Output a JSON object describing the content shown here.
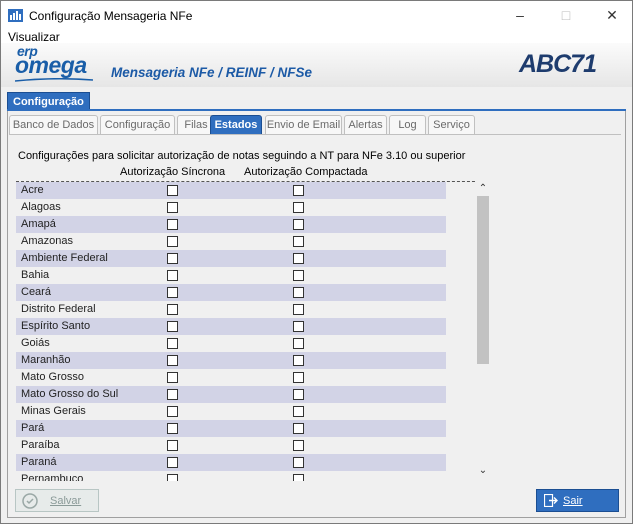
{
  "window": {
    "title": "Configuração Mensageria NFe"
  },
  "menu": {
    "items": [
      "Visualizar"
    ]
  },
  "banner": {
    "logo_erp": "erp",
    "logo_omega": "omega",
    "title": "Mensageria NFe / REINF / NFSe",
    "brand": "ABC71"
  },
  "main_tab": {
    "label": "Configuração"
  },
  "subtabs": [
    "Banco de Dados",
    "Configuração",
    "Filas",
    "Estados",
    "Envio de Email",
    "Alertas",
    "Log",
    "Serviço"
  ],
  "active_subtab": "Estados",
  "content": {
    "description": "Configurações para solicitar autorização de notas seguindo a NT para NFe 3.10 ou superior",
    "col_sincrona": "Autorização Síncrona",
    "col_compactada": "Autorização Compactada"
  },
  "states": [
    {
      "name": "Acre",
      "sincrona": false,
      "compactada": false
    },
    {
      "name": "Alagoas",
      "sincrona": false,
      "compactada": false
    },
    {
      "name": "Amapá",
      "sincrona": false,
      "compactada": false
    },
    {
      "name": "Amazonas",
      "sincrona": false,
      "compactada": false
    },
    {
      "name": "Ambiente Federal",
      "sincrona": false,
      "compactada": false
    },
    {
      "name": "Bahia",
      "sincrona": false,
      "compactada": false
    },
    {
      "name": "Ceará",
      "sincrona": false,
      "compactada": false
    },
    {
      "name": "Distrito Federal",
      "sincrona": false,
      "compactada": false
    },
    {
      "name": "Espírito Santo",
      "sincrona": false,
      "compactada": false
    },
    {
      "name": "Goiás",
      "sincrona": false,
      "compactada": false
    },
    {
      "name": "Maranhão",
      "sincrona": false,
      "compactada": false
    },
    {
      "name": "Mato Grosso",
      "sincrona": false,
      "compactada": false
    },
    {
      "name": "Mato Grosso do Sul",
      "sincrona": false,
      "compactada": false
    },
    {
      "name": "Minas Gerais",
      "sincrona": false,
      "compactada": false
    },
    {
      "name": "Pará",
      "sincrona": false,
      "compactada": false
    },
    {
      "name": "Paraíba",
      "sincrona": false,
      "compactada": false
    },
    {
      "name": "Paraná",
      "sincrona": false,
      "compactada": false
    },
    {
      "name": "Pernambuco",
      "sincrona": false,
      "compactada": false
    }
  ],
  "buttons": {
    "save": "Salvar",
    "exit": "Sair"
  },
  "colors": {
    "accent": "#2f6ebf",
    "row_alt": "#d2d3e6",
    "brand_blue": "#1a5ea8"
  }
}
